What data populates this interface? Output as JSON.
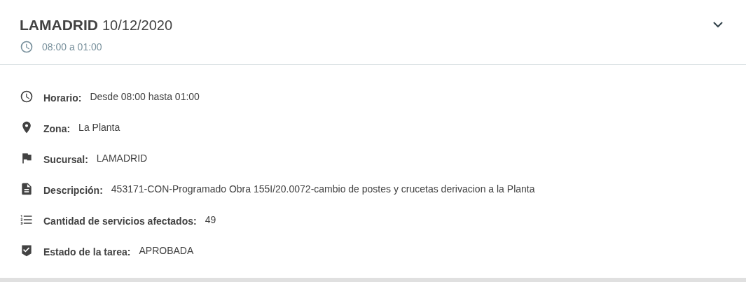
{
  "header": {
    "title": "LAMADRID",
    "date": "10/12/2020",
    "time_range": "08:00 a 01:00"
  },
  "details": [
    {
      "kind": "clock",
      "label": "Horario:",
      "value": "Desde 08:00 hasta 01:00"
    },
    {
      "kind": "pin",
      "label": "Zona:",
      "value": "La Planta"
    },
    {
      "kind": "flag",
      "label": "Sucursal:",
      "value": "LAMADRID"
    },
    {
      "kind": "document",
      "label": "Descripción:",
      "value": "453171-CON-Programado Obra 155I/20.0072-cambio de postes y crucetas derivacion a la Planta"
    },
    {
      "kind": "list",
      "label": "Cantidad de servicios afectados:",
      "value": "49"
    },
    {
      "kind": "shield",
      "label": "Estado de la tarea:",
      "value": "APROBADA"
    }
  ]
}
